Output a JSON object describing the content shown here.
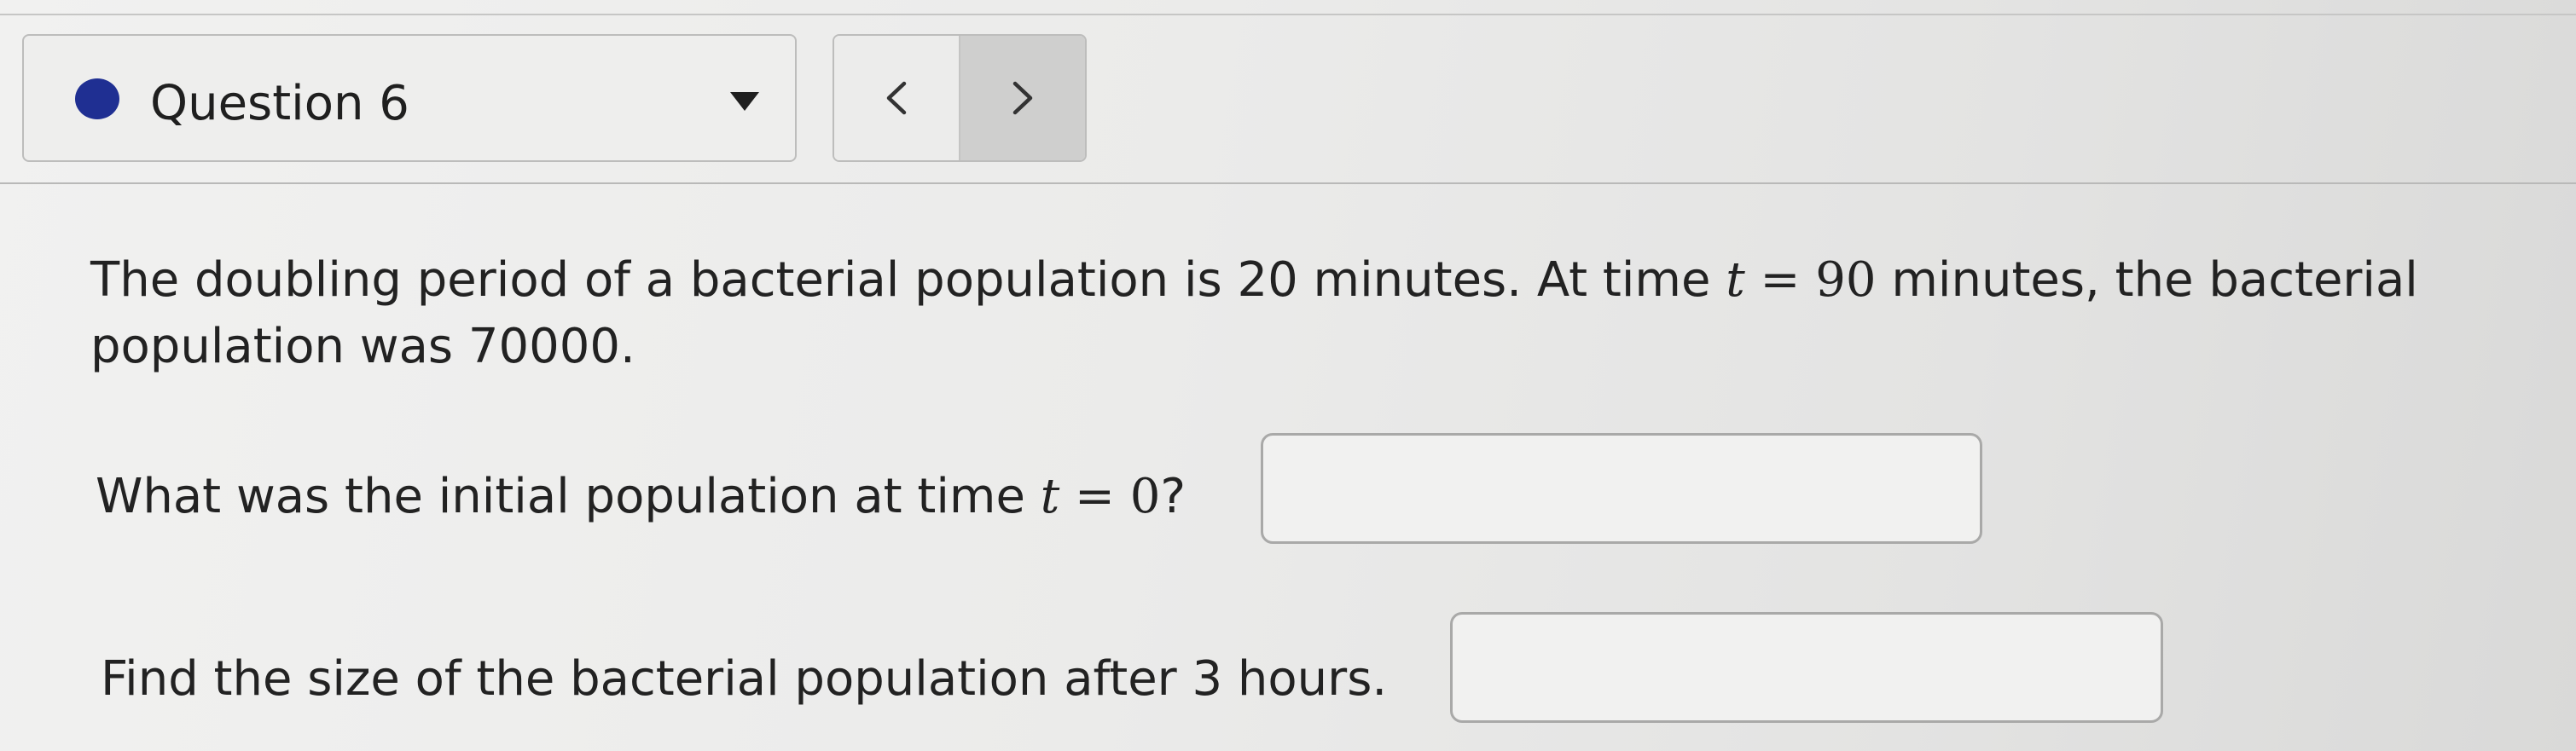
{
  "header": {
    "question_label": "Question 6",
    "status_dot_color": "#1f2f92",
    "dropdown_icon": "triangle-down-icon",
    "prev_label": "<",
    "next_label": ">"
  },
  "problem": {
    "text_before_t": "The doubling period of a bacterial population is 20 minutes. At time ",
    "var_t": "t",
    "equals": " = ",
    "t_value": "90",
    "text_after": " minutes, the bacterial population was 70000."
  },
  "question1": {
    "prefix": "What was the initial population at time ",
    "var_t": "t",
    "equals": " = ",
    "value": "0",
    "suffix": "?",
    "answer_value": ""
  },
  "question2": {
    "text": "Find the size of the bacterial population after 3 hours.",
    "answer_value": ""
  }
}
